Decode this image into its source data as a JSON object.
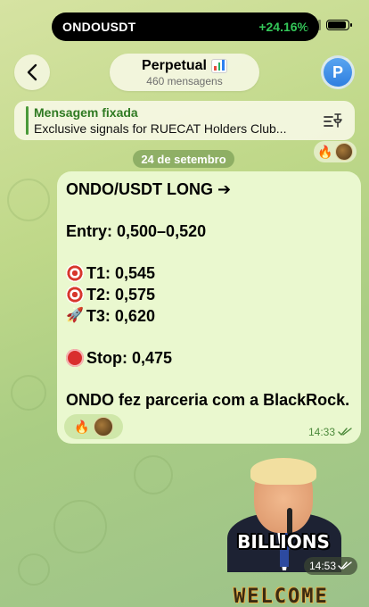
{
  "status_bar": {
    "ticker": "ONDOUSDT",
    "change": "+24.16%",
    "battery_level": 0.9
  },
  "header": {
    "title": "Perpetual",
    "title_icon": "bar-chart-emoji",
    "subtitle": "460 mensagens",
    "avatar_letter": "P",
    "back_icon": "chevron-left-icon"
  },
  "pinned": {
    "label": "Mensagem fixada",
    "text": "Exclusive signals for RUECAT Holders Club...",
    "icon": "pin-list-icon"
  },
  "date_separator": "24 de setembro",
  "message": {
    "lines": {
      "headline": "ONDO/USDT LONG ➔",
      "entry": "Entry: 0,500–0,520",
      "t1": "T1: 0,545",
      "t2": "T2: 0,575",
      "t3": "T3: 0,620",
      "stop": "Stop: 0,475",
      "news": "ONDO fez parceria com a BlackRock."
    },
    "time": "14:33",
    "reactions": [
      "fire",
      "avatar"
    ]
  },
  "sticker": {
    "caption": "BILLIONS",
    "time": "14:53"
  },
  "next_sticker_text": "WELCOME TO"
}
